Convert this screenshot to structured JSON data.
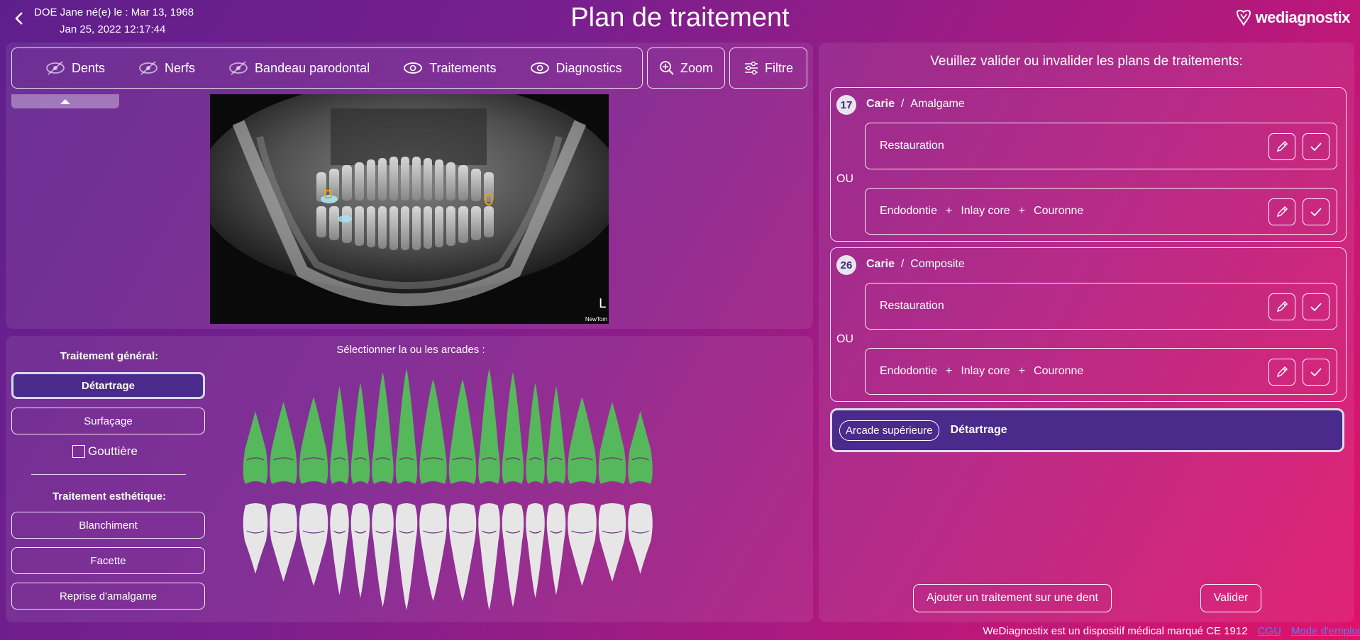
{
  "header": {
    "patient_line1": "DOE Jane né(e) le : Mar 13, 1968",
    "patient_line2": "Jan 25, 2022 12:17:44",
    "title": "Plan de traitement",
    "logo_text": "wediagnostix"
  },
  "toolbar": {
    "items": [
      {
        "label": "Dents",
        "icon": "eye-slash-icon"
      },
      {
        "label": "Nerfs",
        "icon": "eye-slash-icon"
      },
      {
        "label": "Bandeau parodontal",
        "icon": "eye-slash-icon"
      },
      {
        "label": "Traitements",
        "icon": "eye-icon"
      },
      {
        "label": "Diagnostics",
        "icon": "eye-icon"
      }
    ],
    "zoom_label": "Zoom",
    "filter_label": "Filtre"
  },
  "xray": {
    "side_marker": "L",
    "brand": "NewTom"
  },
  "general": {
    "title": "Traitement général:",
    "buttons": [
      "Détartrage",
      "Surfaçage"
    ],
    "active": "Détartrage",
    "checkbox_label": "Gouttière"
  },
  "esthetic": {
    "title": "Traitement esthétique:",
    "buttons": [
      "Blanchiment",
      "Facette",
      "Reprise d'amalgame"
    ]
  },
  "arcades": {
    "label": "Sélectionner la ou les arcades :",
    "upper_selected": true,
    "upper_color": "#55b85a",
    "lower_color": "#e6e6e6"
  },
  "right": {
    "title": "Veuillez valider ou invalider les plans de traitements:",
    "ou_label": "OU",
    "cards": [
      {
        "tooth": "17",
        "diagnosis": "Carie",
        "material": "Amalgame",
        "options": [
          {
            "steps": [
              "Restauration"
            ]
          },
          {
            "steps": [
              "Endodontie",
              "Inlay core",
              "Couronne"
            ]
          }
        ]
      },
      {
        "tooth": "26",
        "diagnosis": "Carie",
        "material": "Composite",
        "options": [
          {
            "steps": [
              "Restauration"
            ]
          },
          {
            "steps": [
              "Endodontie",
              "Inlay core",
              "Couronne"
            ]
          }
        ]
      }
    ],
    "arcade_item": {
      "tag": "Arcade supérieure",
      "treatment": "Détartrage"
    },
    "add_button": "Ajouter un traitement sur une dent",
    "validate_button": "Valider"
  },
  "footer": {
    "notice": "WeDiagnostix est un dispositif médical marqué CE 1912",
    "cgu": "CGU",
    "manual": "Mode d'emploi"
  },
  "colors": {
    "active_bg": "#4a2a8a",
    "badge_bg": "#e8e4f0",
    "link": "#3a8df0"
  }
}
